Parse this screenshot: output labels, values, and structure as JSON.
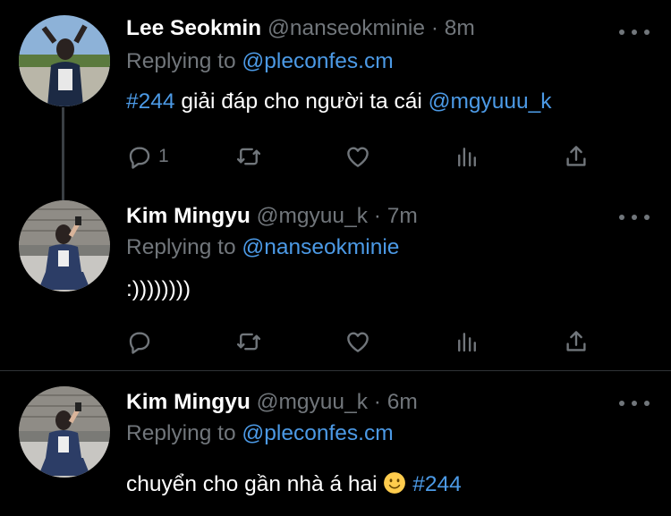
{
  "tweets": [
    {
      "name": "Lee Seokmin",
      "handle": "@nanseokminie",
      "dot": "·",
      "time": "8m",
      "replying_prefix": "Replying to",
      "replying_to": "@pleconfes.cm",
      "text_parts": [
        "#244",
        " giải đáp cho người ta cái ",
        "@mgyuuu_k"
      ],
      "reply_count": "1"
    },
    {
      "name": "Kim Mingyu",
      "handle": "@mgyuu_k",
      "dot": "·",
      "time": "7m",
      "replying_prefix": "Replying to",
      "replying_to": "@nanseokminie",
      "text": ":))))))))",
      "reply_count": ""
    },
    {
      "name": "Kim Mingyu",
      "handle": "@mgyuu_k",
      "dot": "·",
      "time": "6m",
      "replying_prefix": "Replying to",
      "replying_to": "@pleconfes.cm",
      "text_parts": [
        "chuyển cho gần nhà á hai ",
        "#244"
      ],
      "emoji": "slightly-smiling-face"
    }
  ],
  "colors": {
    "background": "#000000",
    "link": "#4c9ae6",
    "muted": "#71767b",
    "divider": "#2f3336"
  },
  "icons": [
    "reply-icon",
    "retweet-icon",
    "like-icon",
    "analytics-icon",
    "share-icon",
    "more-icon"
  ]
}
